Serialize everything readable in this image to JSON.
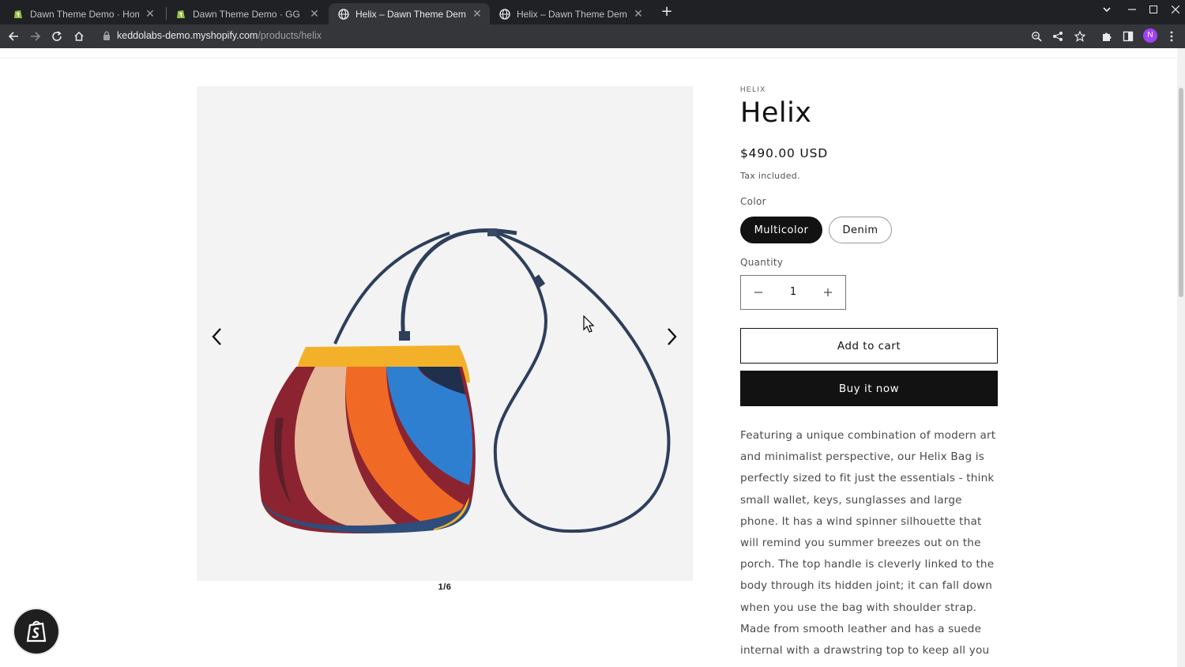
{
  "browser": {
    "tabs": [
      {
        "title": "Dawn Theme Demo · Home · S",
        "active": false,
        "favicon": "shopify-icon"
      },
      {
        "title": "Dawn Theme Demo · GG Prod",
        "active": false,
        "favicon": "shopify-icon"
      },
      {
        "title": "Helix – Dawn Theme Demo",
        "active": true,
        "favicon": "globe-icon"
      },
      {
        "title": "Helix – Dawn Theme Demo",
        "active": false,
        "favicon": "globe-icon"
      }
    ],
    "url_host": "keddolabs-demo.myshopify.com",
    "url_path": "/products/helix",
    "profile_initial": "N",
    "profile_color": "#a142f4"
  },
  "product": {
    "vendor": "HELIX",
    "title": "Helix",
    "price": "$490.00 USD",
    "tax_note": "Tax included.",
    "color_label": "Color",
    "color_options": [
      "Multicolor",
      "Denim"
    ],
    "selected_color": "Multicolor",
    "quantity_label": "Quantity",
    "quantity": "1",
    "add_to_cart": "Add to cart",
    "buy_now": "Buy it now",
    "description": "Featuring a unique combination of modern art and minimalist perspective, our Helix Bag is perfectly sized to fit just the essentials - think small wallet, keys, sunglasses and large phone. It has a wind spinner silhouette that will remind you summer breezes out on the porch. The top handle is cleverly linked to the body through its hidden joint; it can fall down when you use the bag with shoulder strap. Made from smooth leather and has a suede internal with a drawstring top to keep all you have stowed"
  },
  "gallery": {
    "counter": "1/6",
    "image_subject": "multicolor spiral leather bucket bag with navy strap"
  },
  "colors": {
    "accent": "#121212",
    "chrome_dark": "#202124",
    "chrome_toolbar": "#35363a"
  }
}
